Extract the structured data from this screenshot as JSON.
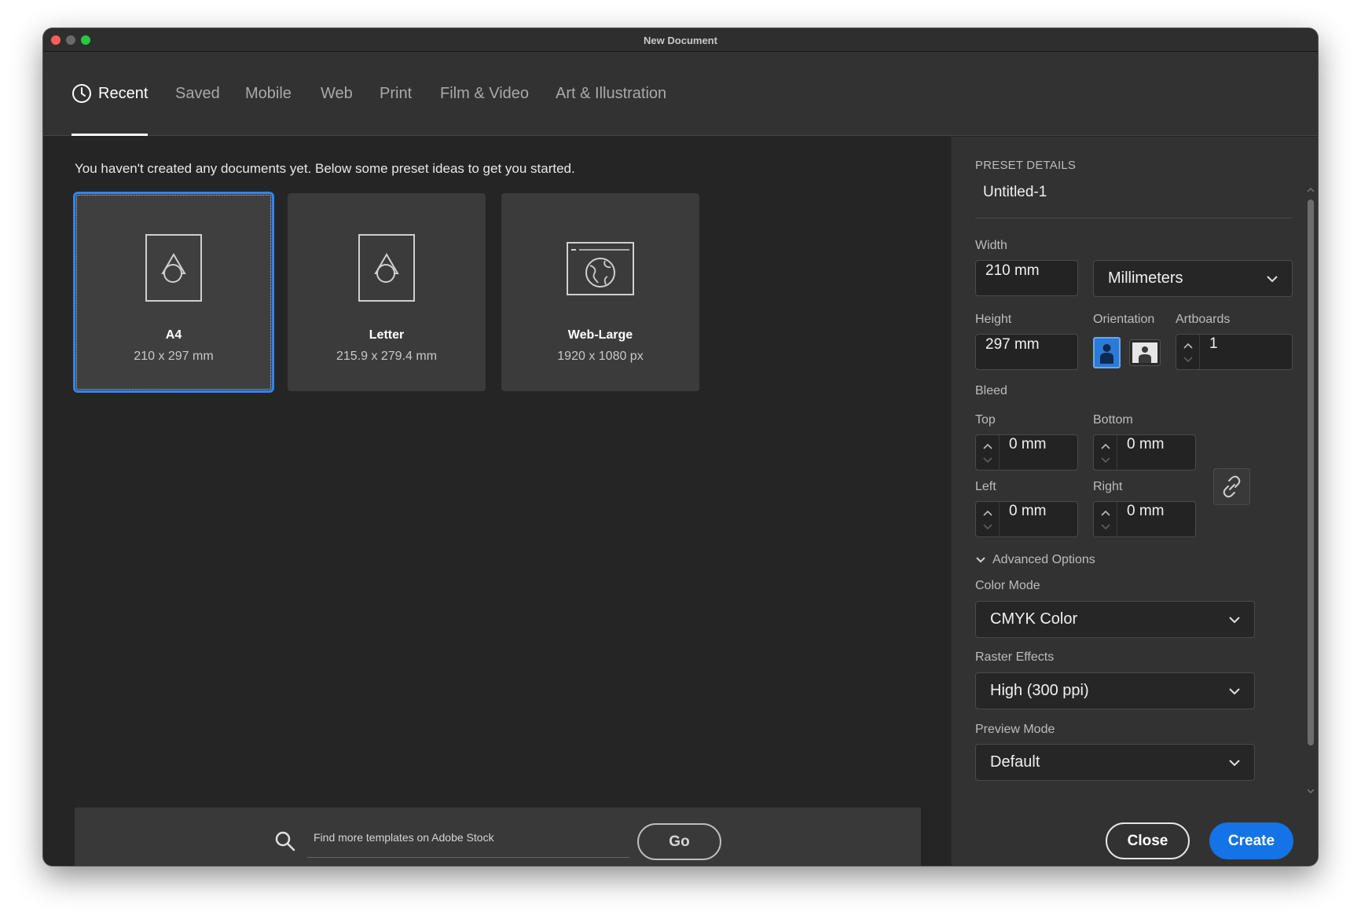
{
  "window": {
    "title": "New Document"
  },
  "tabs": [
    {
      "label": "Recent",
      "icon": "clock-icon",
      "active": true
    },
    {
      "label": "Saved"
    },
    {
      "label": "Mobile"
    },
    {
      "label": "Web"
    },
    {
      "label": "Print"
    },
    {
      "label": "Film & Video"
    },
    {
      "label": "Art & Illustration"
    }
  ],
  "main": {
    "intro": "You haven't created any documents yet. Below some preset ideas to get you started.",
    "presets": [
      {
        "name": "A4",
        "size": "210 x 297 mm",
        "icon": "print-document-icon",
        "selected": true
      },
      {
        "name": "Letter",
        "size": "215.9 x 279.4 mm",
        "icon": "print-document-icon"
      },
      {
        "name": "Web-Large",
        "size": "1920 x 1080 px",
        "icon": "web-document-icon"
      }
    ],
    "stock": {
      "placeholder": "Find more templates on Adobe Stock",
      "go_label": "Go"
    }
  },
  "details": {
    "heading": "PRESET DETAILS",
    "document_name": "Untitled-1",
    "width_label": "Width",
    "width_value": "210 mm",
    "units": "Millimeters",
    "height_label": "Height",
    "height_value": "297 mm",
    "orientation_label": "Orientation",
    "orientation_selected": "portrait",
    "artboards_label": "Artboards",
    "artboards_value": "1",
    "bleed_label": "Bleed",
    "bleed": {
      "top_label": "Top",
      "top_value": "0 mm",
      "bottom_label": "Bottom",
      "bottom_value": "0 mm",
      "left_label": "Left",
      "left_value": "0 mm",
      "right_label": "Right",
      "right_value": "0 mm"
    },
    "advanced_label": "Advanced Options",
    "color_mode_label": "Color Mode",
    "color_mode_value": "CMYK Color",
    "raster_label": "Raster Effects",
    "raster_value": "High (300 ppi)",
    "preview_label": "Preview Mode",
    "preview_value": "Default",
    "close_label": "Close",
    "create_label": "Create"
  },
  "colors": {
    "accent": "#1473e6",
    "selection_outline": "#2e86f0"
  }
}
